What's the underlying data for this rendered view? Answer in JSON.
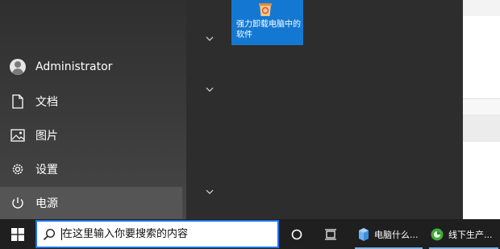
{
  "start_menu": {
    "user": {
      "name": "Administrator"
    },
    "nav": [
      {
        "label": "文档"
      },
      {
        "label": "图片"
      },
      {
        "label": "设置"
      },
      {
        "label": "电源"
      }
    ],
    "tile": {
      "label": "强力卸载电脑中的软件"
    }
  },
  "taskbar": {
    "search_placeholder": "在这里输入你要搜索的内容",
    "apps": [
      {
        "label": "电脑什么..."
      },
      {
        "label": "线下生产..."
      }
    ]
  },
  "colors": {
    "accent": "#1478d2",
    "taskbar": "#1f1f1f",
    "search_border": "#1a73e8"
  }
}
